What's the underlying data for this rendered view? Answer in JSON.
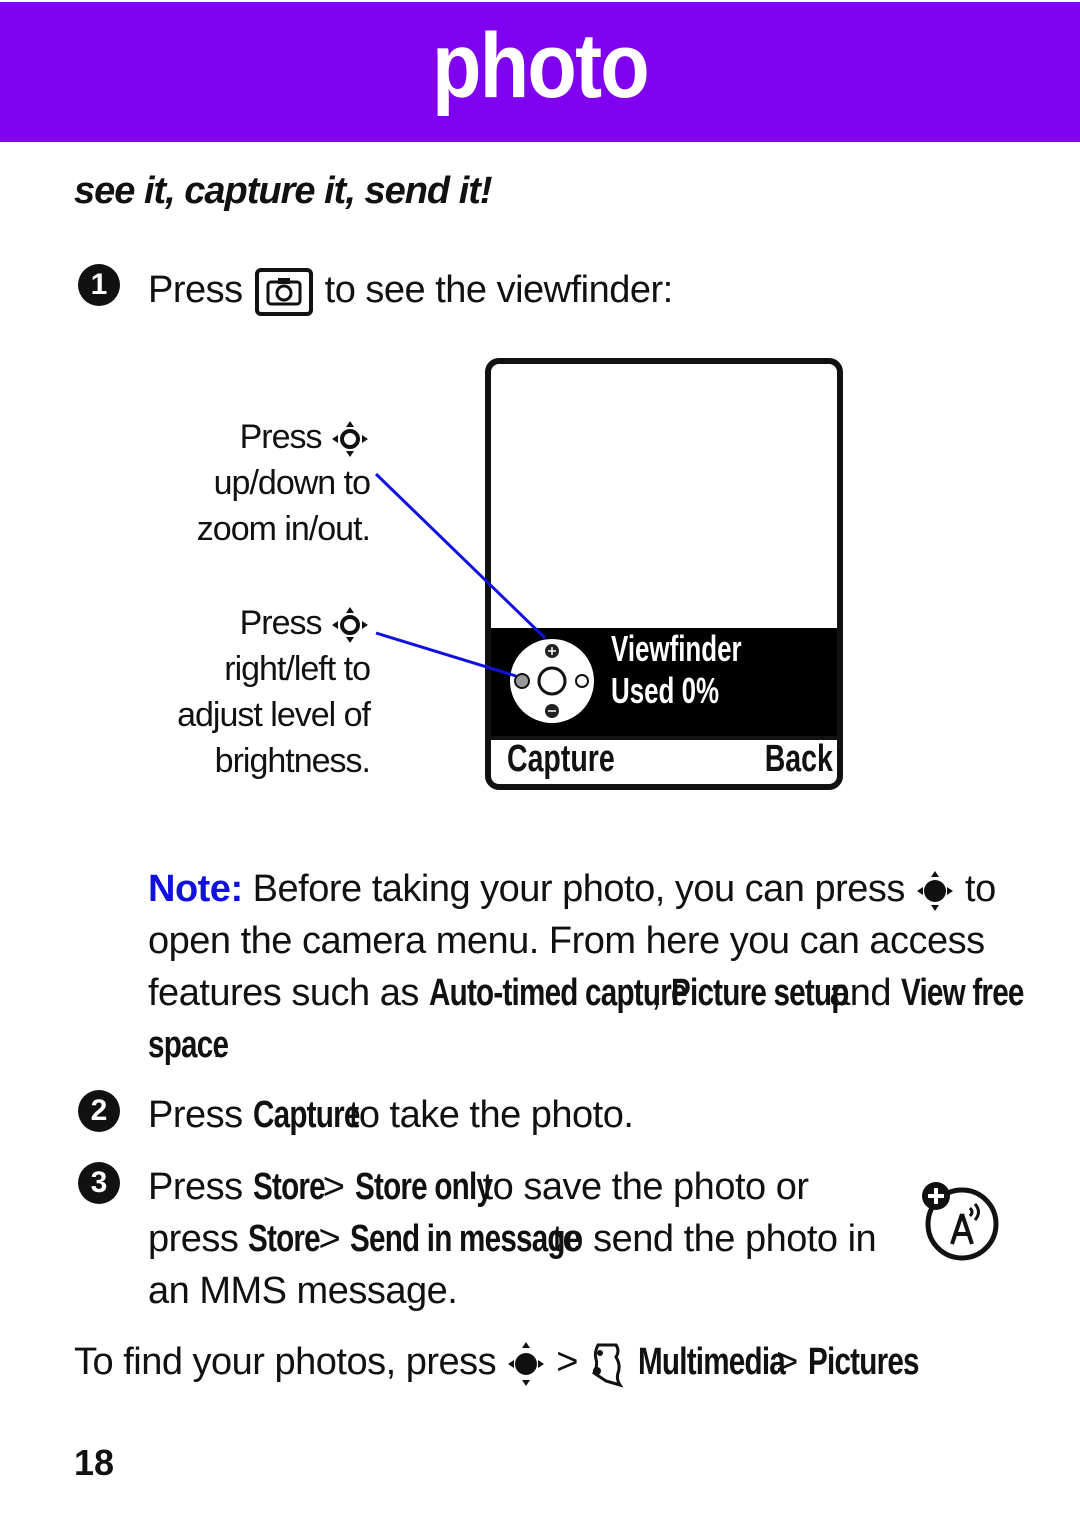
{
  "banner": {
    "title": "photo",
    "color": "#8000f0"
  },
  "subheading": "see it, capture it, send it!",
  "step1": {
    "number": "1",
    "pre": "Press",
    "key_icon": "camera-key-icon",
    "post": "to see the viewfinder:"
  },
  "callouts": {
    "zoom": {
      "line1": "Press",
      "icon": "nav-key-icon",
      "line2": "up/down to",
      "line3": "zoom in/out."
    },
    "brightness": {
      "line1": "Press",
      "icon": "nav-key-icon",
      "line2": "right/left to",
      "line3": "adjust level of",
      "line4": "brightness."
    }
  },
  "viewfinder": {
    "status_line1": "Viewfinder",
    "status_line2": "Used 0%",
    "softkey_left": "Capture",
    "softkey_right": "Back",
    "callout_line_color": "#1010e0"
  },
  "note": {
    "label": "Note:",
    "text1": "Before taking your photo, you can press",
    "text1_end": "to",
    "text2": "open the camera menu. From here you can access",
    "text3_pre": "features such as",
    "feature1": "Auto-timed capture",
    "sep": ",",
    "feature2": "Picture setup",
    "and": "and",
    "feature3a": "View free",
    "feature3b": "space",
    "period": ".",
    "label_color": "#1010e0"
  },
  "step2": {
    "number": "2",
    "pre": "Press",
    "key": "Capture",
    "post": "to take the photo."
  },
  "step3": {
    "number": "3",
    "pre": "Press",
    "store": "Store",
    "gt": ">",
    "store_only": "Store only",
    "mid": "to save the photo or",
    "pre2": "press",
    "send": "Send in message",
    "post2": "to send the photo in",
    "line3": "an MMS message.",
    "side_icon": "network-feature-icon"
  },
  "find": {
    "pre": "To find your photos, press",
    "gt": ">",
    "menu1": "Multimedia",
    "menu2": "Pictures",
    "period": "."
  },
  "page_number": "18"
}
